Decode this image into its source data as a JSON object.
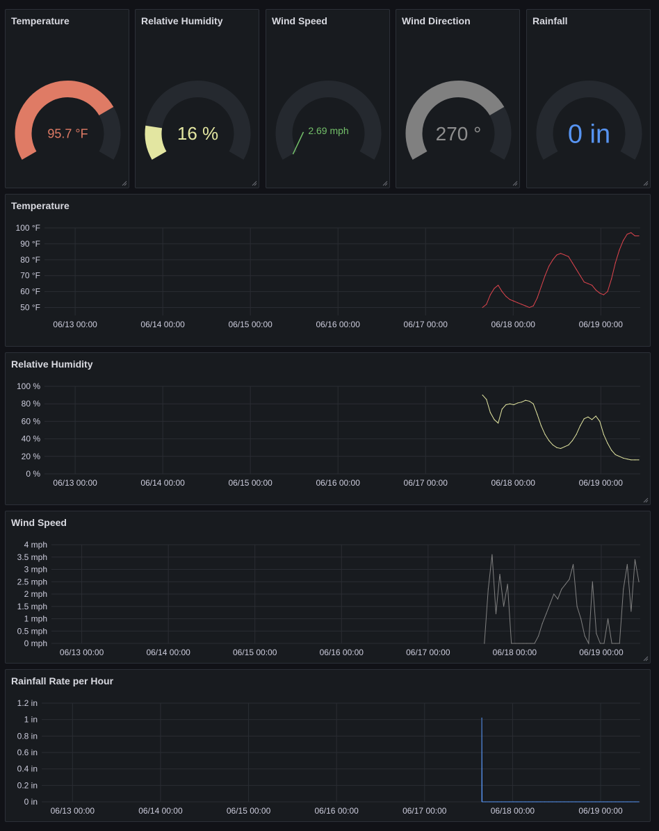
{
  "gauges": [
    {
      "title": "Temperature",
      "value": "95.7 °F",
      "fraction": 0.75,
      "color": "#df7b65",
      "text_color": "#df7b65",
      "font_size": 18
    },
    {
      "title": "Relative Humidity",
      "value": "16 %",
      "fraction": 0.16,
      "color": "#e3e6a1",
      "text_color": "#e3e6a1",
      "font_size": 26
    },
    {
      "title": "Wind Speed",
      "value": "2.69 mph",
      "fraction": 0.0,
      "color": "#73bf69",
      "text_color": "#73bf69",
      "font_size": 14
    },
    {
      "title": "Wind Direction",
      "value": "270 °",
      "fraction": 0.75,
      "color": "#808080",
      "text_color": "#8e8e8e",
      "font_size": 28
    },
    {
      "title": "Rainfall",
      "value": "0 in",
      "fraction": 0.0,
      "color": "#5794f2",
      "text_color": "#5794f2",
      "font_size": 38
    }
  ],
  "gauge_track_color": "#25292f",
  "x_ticks": [
    "06/13 00:00",
    "06/14 00:00",
    "06/15 00:00",
    "06/16 00:00",
    "06/17 00:00",
    "06/18 00:00",
    "06/19 00:00"
  ],
  "chart_data": [
    {
      "type": "line",
      "title": "Temperature",
      "color": "#e0454e",
      "y_ticks": [
        "50 °F",
        "60 °F",
        "70 °F",
        "80 °F",
        "90 °F",
        "100 °F"
      ],
      "ylim": [
        45,
        100
      ],
      "x_start": "06/17 15:30",
      "series": [
        {
          "values": [
            50,
            52,
            58,
            62,
            64,
            60,
            57,
            55,
            54,
            53,
            52,
            51,
            50,
            51,
            56,
            63,
            70,
            76,
            80,
            83,
            84,
            83,
            82,
            78,
            74,
            70,
            66,
            65,
            64,
            61,
            59,
            58,
            60,
            68,
            78,
            86,
            92,
            96,
            97,
            95,
            95
          ]
        }
      ]
    },
    {
      "type": "line",
      "title": "Relative Humidity",
      "color": "#e3e6a1",
      "y_ticks": [
        "0 %",
        "20 %",
        "40 %",
        "60 %",
        "80 %",
        "100 %"
      ],
      "ylim": [
        0,
        100
      ],
      "x_start": "06/17 15:30",
      "series": [
        {
          "values": [
            90,
            85,
            70,
            62,
            58,
            74,
            79,
            80,
            79,
            81,
            82,
            84,
            83,
            80,
            68,
            55,
            45,
            38,
            33,
            30,
            29,
            31,
            33,
            38,
            45,
            55,
            63,
            65,
            62,
            66,
            60,
            45,
            35,
            27,
            22,
            20,
            18,
            17,
            16,
            16,
            16
          ]
        }
      ]
    },
    {
      "type": "line",
      "title": "Wind Speed",
      "color": "#808080",
      "y_ticks": [
        "0 mph",
        "0.5 mph",
        "1 mph",
        "1.5 mph",
        "2 mph",
        "2.5 mph",
        "3 mph",
        "3.5 mph",
        "4 mph"
      ],
      "ylim": [
        0,
        4
      ],
      "x_start": "06/17 15:30",
      "series": [
        {
          "values": [
            0,
            2.2,
            3.6,
            1.2,
            2.8,
            1.5,
            2.4,
            0,
            0,
            0,
            0,
            0,
            0,
            0,
            0.3,
            0.8,
            1.2,
            1.6,
            2.0,
            1.8,
            2.2,
            2.4,
            2.6,
            3.2,
            1.5,
            1.0,
            0.3,
            0,
            2.5,
            0.4,
            0,
            0,
            1.0,
            0,
            0,
            0,
            2.2,
            3.2,
            1.3,
            3.4,
            2.5
          ]
        }
      ]
    },
    {
      "type": "line",
      "title": "Rainfall Rate per Hour",
      "color": "#5794f2",
      "y_ticks": [
        "0 in",
        "0.2 in",
        "0.4 in",
        "0.6 in",
        "0.8 in",
        "1 in",
        "1.2 in"
      ],
      "ylim": [
        0,
        1.2
      ],
      "x_start": "06/17 15:30",
      "series": [
        {
          "values": [
            1.02,
            0,
            0,
            0,
            0,
            0,
            0,
            0,
            0,
            0,
            0,
            0,
            0,
            0,
            0,
            0,
            0,
            0,
            0,
            0,
            0,
            0,
            0,
            0,
            0,
            0,
            0,
            0,
            0,
            0,
            0,
            0,
            0,
            0,
            0,
            0,
            0,
            0,
            0,
            0,
            0
          ]
        }
      ]
    }
  ]
}
